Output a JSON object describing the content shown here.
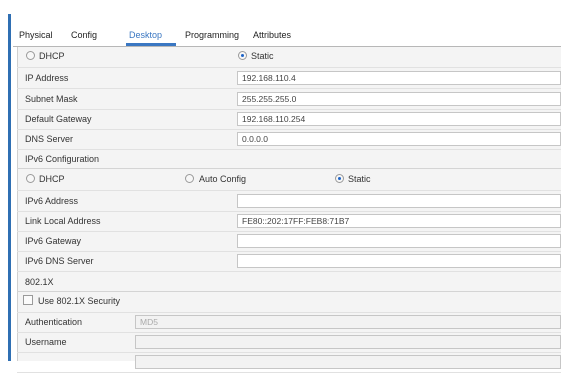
{
  "tabs": [
    "Physical",
    "Config",
    "Desktop",
    "Programming",
    "Attributes"
  ],
  "active_tab": "Desktop",
  "ipv4": {
    "dhcp_label": "DHCP",
    "static_label": "Static",
    "mode": "Static",
    "ip_address_label": "IP Address",
    "ip_address": "192.168.110.4",
    "subnet_mask_label": "Subnet Mask",
    "subnet_mask": "255.255.255.0",
    "default_gateway_label": "Default Gateway",
    "default_gateway": "192.168.110.254",
    "dns_server_label": "DNS Server",
    "dns_server": "0.0.0.0"
  },
  "ipv6": {
    "section_label": "IPv6 Configuration",
    "dhcp_label": "DHCP",
    "auto_config_label": "Auto Config",
    "static_label": "Static",
    "mode": "Static",
    "address_label": "IPv6 Address",
    "address": "",
    "link_local_label": "Link Local Address",
    "link_local": "FE80::202:17FF:FEB8:71B7",
    "gateway_label": "IPv6 Gateway",
    "gateway": "",
    "dns_label": "IPv6 DNS Server",
    "dns": ""
  },
  "dot1x": {
    "section_label": "802.1X",
    "use_security_label": "Use 802.1X Security",
    "use_security_checked": false,
    "authentication_label": "Authentication",
    "authentication_value": "MD5",
    "username_label": "Username",
    "username": ""
  }
}
